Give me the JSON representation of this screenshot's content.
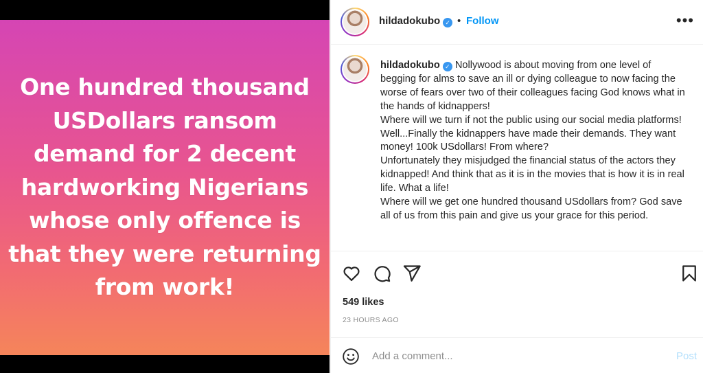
{
  "media": {
    "image_text": "One hundred thousand USDollars ransom demand for 2 decent hardworking Nigerians whose only offence is that they were returning from work!",
    "gradient_colors": [
      "#d545b4",
      "#e8558f",
      "#f26b72",
      "#f5855a"
    ]
  },
  "header": {
    "username": "hildadokubo",
    "separator": "•",
    "follow_label": "Follow",
    "more_icon": "more-options-icon"
  },
  "caption": {
    "username": "hildadokubo",
    "lines": [
      "Nollywood is about moving from one level of begging for alms to save an ill or dying colleague to now facing the worse of fears over two of their colleagues facing God knows what in the hands of kidnappers!",
      "Where will we turn if not the public using our social media platforms!",
      "Well...Finally the kidnappers have made their demands. They want money! 100k USdollars! From where?",
      "Unfortunately they misjudged the financial status of the actors they kidnapped! And think that as it is in the movies that is how it is in real life. What a life!",
      "Where will we get one hundred thousand USdollars from? God save all of us from this pain and give us your grace for this period."
    ]
  },
  "actions": {
    "icons": [
      "heart-icon",
      "comment-icon",
      "share-icon",
      "bookmark-icon"
    ]
  },
  "likes_text": "549 likes",
  "timestamp": "23 HOURS AGO",
  "comment": {
    "placeholder": "Add a comment...",
    "post_label": "Post"
  },
  "colors": {
    "link_blue": "#0095f6",
    "verified_blue": "#3897f0",
    "post_disabled": "#b2dffc",
    "muted_text": "#8e8e8e"
  }
}
